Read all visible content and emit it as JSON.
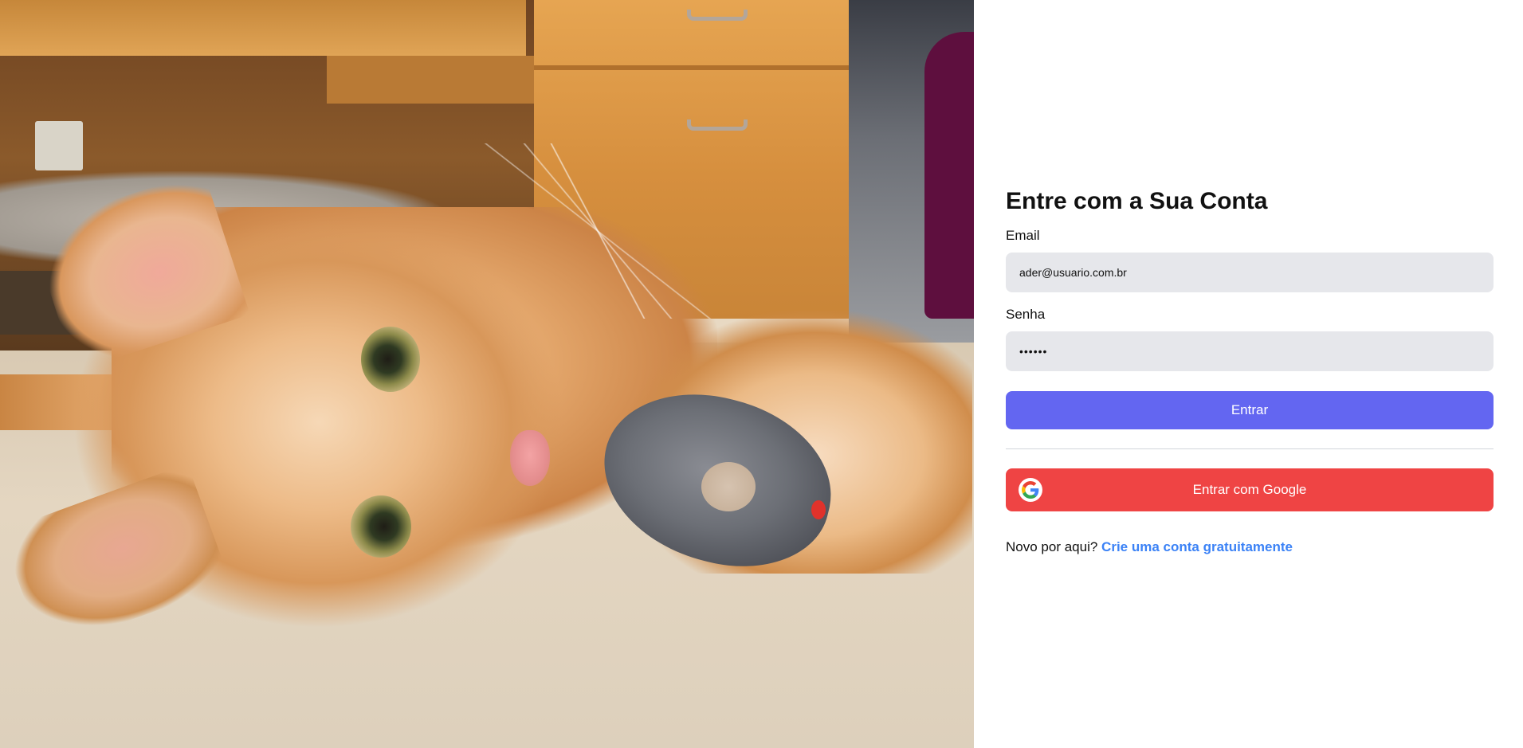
{
  "hero": {
    "image_label": "Gato laranja deitado no chão com um rato de brinquedo"
  },
  "login": {
    "title": "Entre com a Sua Conta",
    "email_label": "Email",
    "email_value": "ader@usuario.com.br",
    "password_label": "Senha",
    "password_masked": "••••••",
    "submit_label": "Entrar",
    "google_label": "Entrar com Google",
    "google_icon": "google-g-icon",
    "signup_prompt": "Novo por aqui?",
    "signup_link": "Crie uma conta gratuitamente"
  },
  "colors": {
    "primary_button": "#6366f1",
    "google_button": "#ef4444",
    "input_background": "#e6e7eb",
    "link": "#3b82f6"
  }
}
